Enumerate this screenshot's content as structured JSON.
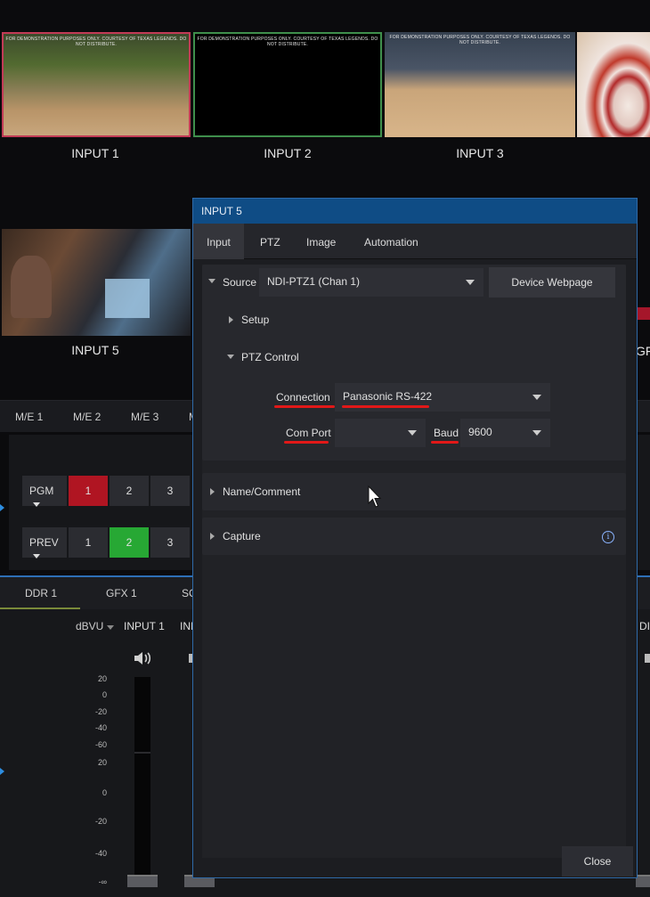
{
  "monitors": [
    {
      "label": "INPUT 1",
      "demo": "FOR DEMONSTRATION PURPOSES ONLY. COURTESY OF TEXAS LEGENDS. DO NOT DISTRIBUTE."
    },
    {
      "label": "INPUT 2",
      "demo": "FOR DEMONSTRATION PURPOSES ONLY. COURTESY OF TEXAS LEGENDS. DO NOT DISTRIBUTE."
    },
    {
      "label": "INPUT 3",
      "demo": "FOR DEMONSTRATION PURPOSES ONLY. COURTESY OF TEXAS LEGENDS. DO NOT DISTRIBUTE."
    },
    {
      "label": "INPUT 5"
    },
    {
      "label": "GFX"
    }
  ],
  "me_tabs": [
    "M/E 1",
    "M/E 2",
    "M/E 3",
    "M"
  ],
  "buses": {
    "pgm_label": "PGM",
    "prev_label": "PREV",
    "buttons": [
      "1",
      "2",
      "3"
    ]
  },
  "bottom_tabs": [
    "DDR 1",
    "GFX 1",
    "SC"
  ],
  "audio": {
    "meter_label": "dBVU",
    "channel": "INPUT 1",
    "channel_next": "INI",
    "right_label": "DI",
    "scale_top": [
      "20",
      "0",
      "-20",
      "-40",
      "-60"
    ],
    "scale_bottom": [
      "20",
      "0",
      "-20",
      "-40",
      "-∞"
    ]
  },
  "dialog": {
    "title": "INPUT 5",
    "tabs": [
      "Input",
      "PTZ",
      "Image",
      "Automation"
    ],
    "source_label": "Source",
    "source_value": "NDI-PTZ1 (Chan 1)",
    "device_webpage": "Device Webpage",
    "setup": "Setup",
    "ptz_control": "PTZ Control",
    "connection_label": "Connection",
    "connection_value": "Panasonic RS-422",
    "com_port_label": "Com Port",
    "com_port_value": "",
    "baud_label": "Baud",
    "baud_value": "9600",
    "name_comment": "Name/Comment",
    "capture": "Capture",
    "info_glyph": "i",
    "close": "Close"
  },
  "colors": {
    "title_bar": "#0f4c85",
    "annotation_red": "#e11818",
    "pgm_red": "#b01522",
    "prev_green": "#27a834"
  }
}
